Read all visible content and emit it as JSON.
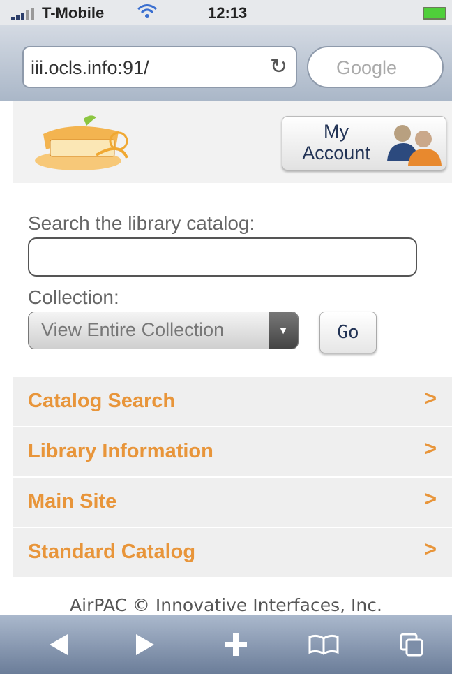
{
  "status_bar": {
    "carrier": "T-Mobile",
    "time": "12:13"
  },
  "browser": {
    "url": "iii.ocls.info:91/",
    "search_placeholder": "Google"
  },
  "header": {
    "account_button": "My\nAccount"
  },
  "search": {
    "label": "Search the library catalog:",
    "value": "",
    "collection_label": "Collection:",
    "collection_selected": "View Entire Collection",
    "go_label": "Go"
  },
  "menu": {
    "items": [
      {
        "label": "Catalog Search"
      },
      {
        "label": "Library Information"
      },
      {
        "label": "Main Site"
      },
      {
        "label": "Standard Catalog"
      }
    ]
  },
  "footer": {
    "text": "AirPAC © Innovative Interfaces, Inc."
  },
  "colors": {
    "accent": "#e8953a",
    "toolbar": "#7d8ea8"
  },
  "icons": [
    "wifi-icon",
    "reload-icon",
    "chevron-right-icon",
    "back-icon",
    "forward-icon",
    "add-bookmark-icon",
    "bookmarks-icon",
    "pages-icon"
  ]
}
